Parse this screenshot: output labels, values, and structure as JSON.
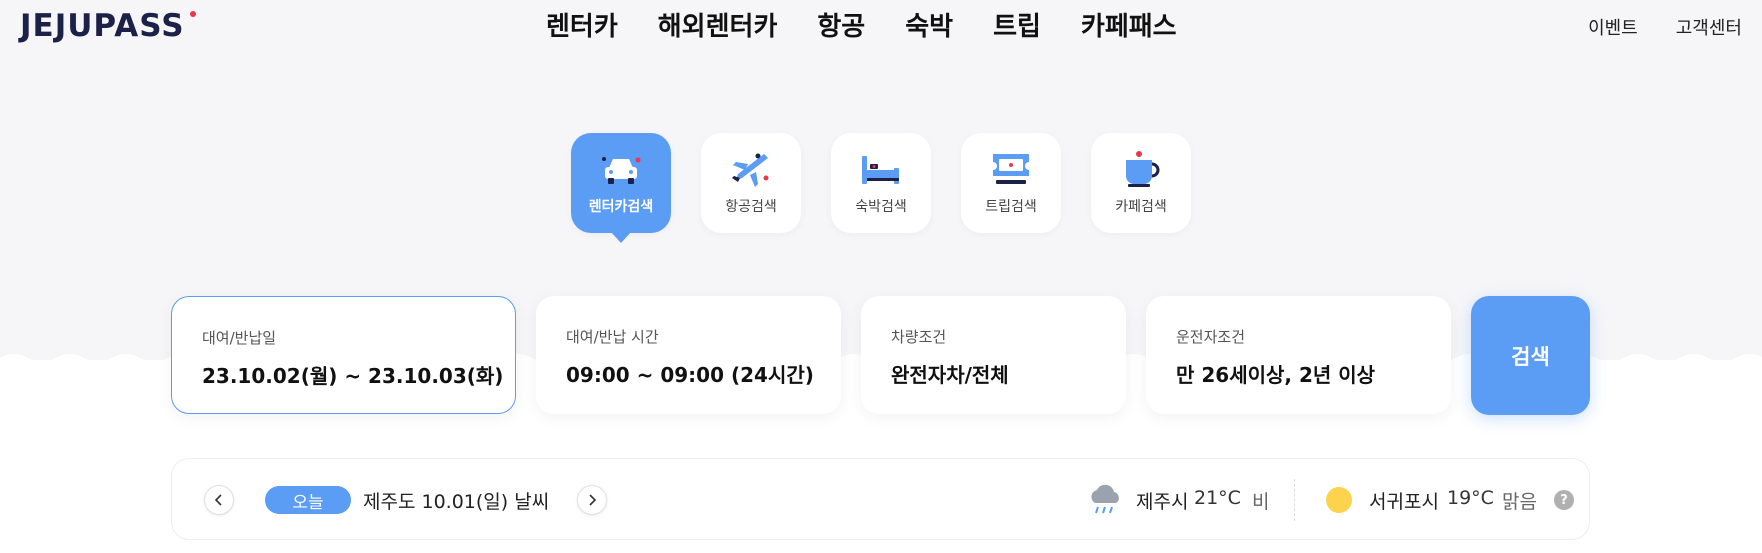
{
  "header": {
    "logo": "JEJUPASS",
    "nav": [
      "렌터카",
      "해외렌터카",
      "항공",
      "숙박",
      "트립",
      "카페패스"
    ],
    "util": [
      "이벤트",
      "고객센터"
    ]
  },
  "tabs": [
    {
      "label": "렌터카검색",
      "icon": "car-icon",
      "active": true
    },
    {
      "label": "항공검색",
      "icon": "airplane-icon",
      "active": false
    },
    {
      "label": "숙박검색",
      "icon": "bed-icon",
      "active": false
    },
    {
      "label": "트립검색",
      "icon": "ticket-icon",
      "active": false
    },
    {
      "label": "카페검색",
      "icon": "coffee-cup-icon",
      "active": false
    }
  ],
  "search": {
    "dates": {
      "label": "대여/반납일",
      "value": "23.10.02(월) ~ 23.10.03(화)"
    },
    "times": {
      "label": "대여/반납 시간",
      "value": "09:00 ~ 09:00 (24시간)"
    },
    "vehicle": {
      "label": "차량조건",
      "value": "완전자차/전체"
    },
    "driver": {
      "label": "운전자조건",
      "value": "만 26세이상, 2년 이상"
    },
    "button": "검색"
  },
  "weather": {
    "today_badge": "오늘",
    "date_text": "제주도 10.01(일) 날씨",
    "cities": [
      {
        "name": "제주시",
        "temp": "21°C",
        "condition": "비",
        "icon": "rain-cloud-icon"
      },
      {
        "name": "서귀포시",
        "temp": "19°C",
        "condition": "맑음",
        "icon": "sun-icon"
      }
    ],
    "help": "?"
  },
  "colors": {
    "accent": "#5b9cf5",
    "logo": "#1b2147",
    "logo_dot": "#e8384f",
    "background": "#f6f6f8"
  }
}
